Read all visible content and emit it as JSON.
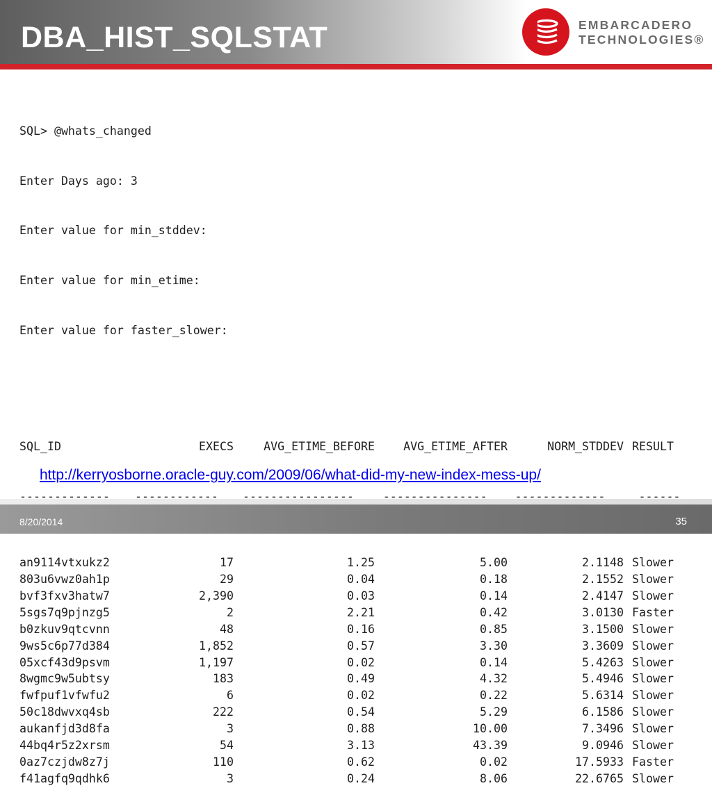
{
  "slide": {
    "title": "DBA_HIST_SQLSTAT",
    "logo": {
      "line1": "EMBARCADERO",
      "line2": "TECHNOLOGIES®",
      "brand_color": "#d6141e"
    },
    "accent_bar_color": "#d2232a"
  },
  "console": {
    "prompt_lines": [
      "SQL> @whats_changed",
      "Enter Days ago: 3",
      "Enter value for min_stddev:",
      "Enter value for min_etime:",
      "Enter value for faster_slower:"
    ],
    "columns": [
      "SQL_ID",
      "EXECS",
      "AVG_ETIME_BEFORE",
      "AVG_ETIME_AFTER",
      "NORM_STDDEV",
      "RESULT"
    ],
    "separators": [
      "-------------",
      "------------",
      "----------------",
      "---------------",
      "-------------",
      "------"
    ],
    "rows": [
      [
        "an9114vtxukz2",
        "17",
        "1.25",
        "5.00",
        "2.1148",
        "Slower"
      ],
      [
        "803u6vwz0ah1p",
        "29",
        "0.04",
        "0.18",
        "2.1552",
        "Slower"
      ],
      [
        "bvf3fxv3hatw7",
        "2,390",
        "0.03",
        "0.14",
        "2.4147",
        "Slower"
      ],
      [
        "5sgs7q9pjnzg5",
        "2",
        "2.21",
        "0.42",
        "3.0130",
        "Faster"
      ],
      [
        "b0zkuv9qtcvnn",
        "48",
        "0.16",
        "0.85",
        "3.1500",
        "Slower"
      ],
      [
        "9ws5c6p77d384",
        "1,852",
        "0.57",
        "3.30",
        "3.3609",
        "Slower"
      ],
      [
        "05xcf43d9psvm",
        "1,197",
        "0.02",
        "0.14",
        "5.4263",
        "Slower"
      ],
      [
        "8wgmc9w5ubtsy",
        "183",
        "0.49",
        "4.32",
        "5.4946",
        "Slower"
      ],
      [
        "fwfpuf1vfwfu2",
        "6",
        "0.02",
        "0.22",
        "5.6314",
        "Slower"
      ],
      [
        "50c18dwvxq4sb",
        "222",
        "0.54",
        "5.29",
        "6.1586",
        "Slower"
      ],
      [
        "aukanfjd3d8fa",
        "3",
        "0.88",
        "10.00",
        "7.3496",
        "Slower"
      ],
      [
        "44bq4r5z2xrsm",
        "54",
        "3.13",
        "43.39",
        "9.0946",
        "Slower"
      ],
      [
        "0az7czjdw8z7j",
        "110",
        "0.62",
        "0.02",
        "17.5933",
        "Faster"
      ],
      [
        "f41agfq9qdhk6",
        "3",
        "0.24",
        "8.06",
        "22.6765",
        "Slower"
      ]
    ]
  },
  "link": {
    "text": "http://kerryosborne.oracle-guy.com/2009/06/what-did-my-new-index-mess-up/"
  },
  "footer": {
    "date": "8/20/2014",
    "page": "35"
  }
}
